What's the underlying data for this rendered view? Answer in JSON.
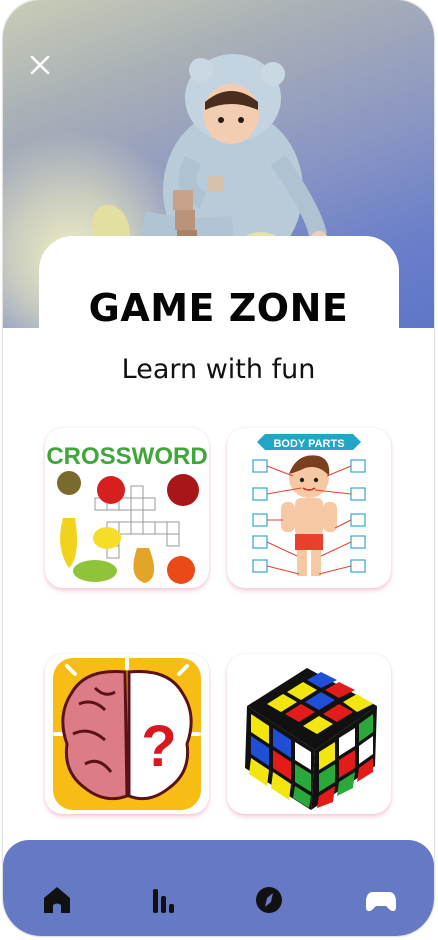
{
  "header": {
    "title": "GAME ZONE",
    "subtitle": "Learn with fun",
    "close_icon": "close-icon"
  },
  "games": [
    {
      "name": "Crossword",
      "image_text": "CROSSWORD",
      "icon": "crossword-puzzle-image"
    },
    {
      "name": "Body Parts",
      "image_text": "BODY PARTS",
      "icon": "body-parts-image"
    },
    {
      "name": "Brain Puzzle",
      "image_text": "?",
      "icon": "brain-question-image"
    },
    {
      "name": "Rubik's Cube",
      "icon": "rubiks-cube-image"
    }
  ],
  "bottom_nav": {
    "items": [
      {
        "id": "home",
        "icon": "home-icon"
      },
      {
        "id": "stats",
        "icon": "bar-chart-icon"
      },
      {
        "id": "explore",
        "icon": "compass-icon"
      },
      {
        "id": "games",
        "icon": "gamepad-icon",
        "active": true
      }
    ]
  },
  "colors": {
    "nav_background": "#6679c4",
    "hero_top": "#5e76c8",
    "hero_glow": "#f3efc3",
    "title_text": "#050505"
  }
}
